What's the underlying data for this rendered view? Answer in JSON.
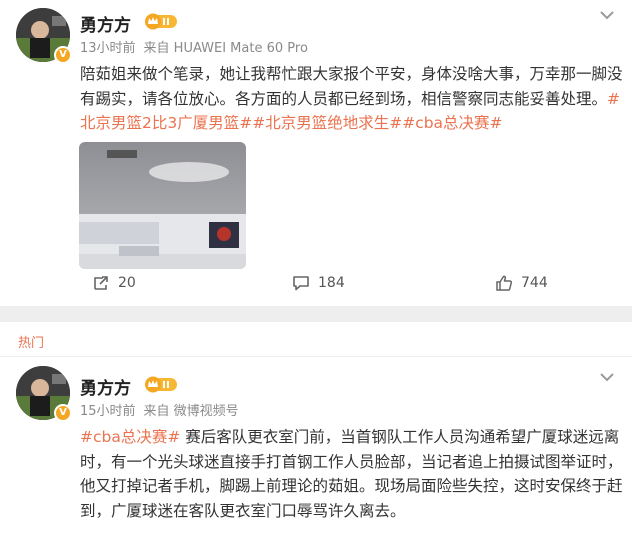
{
  "post1": {
    "username": "勇方方",
    "time": "13小时前",
    "source": "来自 HUAWEI Mate 60 Pro",
    "text_before": "陪茹姐来做个笔录，她让我帮忙跟大家报个平安，身体没啥大事，万幸那一脚没有踢实，请各位放心。各方面的人员都已经到场，相信警察同志能妥善处理。",
    "topics": [
      "#北京男篮2比3广厦男篮#",
      "#北京男篮绝地求生#",
      "#cba总决赛#"
    ],
    "actions": {
      "repost": "20",
      "comment": "184",
      "like": "744"
    }
  },
  "section": {
    "label": "热门"
  },
  "post2": {
    "username": "勇方方",
    "time": "15小时前",
    "source": "来自 微博视频号",
    "topic": "#cba总决赛#",
    "text": " 赛后客队更衣室门前，当首钢队工作人员沟通希望广厦球迷远离时，有一个光头球迷直接手打首钢工作人员脸部，当记者追上拍摄试图举证时，他又打掉记者手机，脚踢上前理论的茹姐。现场局面险些失控，这时安保终于赶到，广厦球迷在客队更衣室门口辱骂许久离去。"
  },
  "colors": {
    "topic": "#eb7350",
    "meta": "#8a8a8a",
    "vip": "#f5a623"
  },
  "icons": [
    "more-chevron-icon",
    "crown-badge-icon",
    "verified-icon",
    "repost-icon",
    "comment-icon",
    "like-icon"
  ]
}
